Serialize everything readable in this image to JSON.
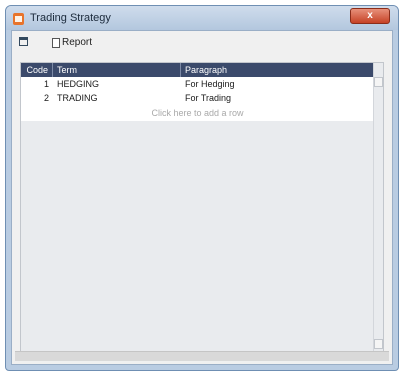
{
  "window": {
    "title": "Trading Strategy",
    "close_label": "x"
  },
  "toolbar": {
    "report_label": "Report"
  },
  "grid": {
    "columns": [
      "Code",
      "Term",
      "Paragraph"
    ],
    "rows": [
      {
        "code": "1",
        "term": "HEDGING",
        "paragraph": "For Hedging"
      },
      {
        "code": "2",
        "term": "TRADING",
        "paragraph": "For Trading"
      }
    ],
    "add_row_text": "Click here to add a row"
  }
}
